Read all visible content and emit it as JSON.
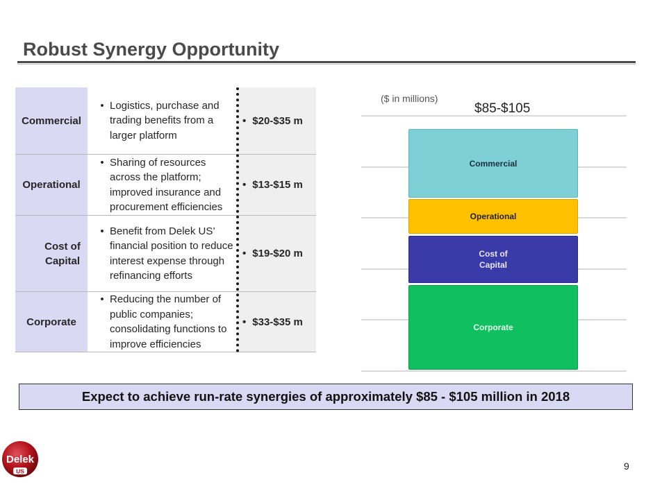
{
  "title": "Robust Synergy Opportunity",
  "rows": [
    {
      "category": "Commercial",
      "description": "Logistics, purchase and trading benefits from a larger platform",
      "value": "$20-$35 m"
    },
    {
      "category": "Operational",
      "description": "Sharing of resources across the platform; improved insurance and procurement efficiencies",
      "value": "$13-$15 m"
    },
    {
      "category": "Cost of Capital",
      "description": "Benefit from Delek US’ financial position to reduce interest expense through refinancing efforts",
      "value": "$19-$20 m"
    },
    {
      "category": "Corporate",
      "description": "Reducing the number of public companies; consolidating functions to improve efficiencies",
      "value": "$33-$35 m"
    }
  ],
  "bullet": "•",
  "chart_data": {
    "type": "bar",
    "units_label": "($ in millions)",
    "total_label": "$85-$105",
    "stacked_segments": [
      "Commercial",
      "Operational",
      "Cost of Capital",
      "Corporate"
    ],
    "colors": {
      "Commercial": "#7ecfd6",
      "Operational": "#ffc000",
      "Cost of Capital": "#3a3aa8",
      "Corporate": "#10c060"
    }
  },
  "banner": "Expect to achieve run-rate synergies of approximately $85 - $105 million in 2018",
  "logo": {
    "text_top": "Delek",
    "text_bottom": "US",
    "color": "#b3121a"
  },
  "page_number": "9"
}
